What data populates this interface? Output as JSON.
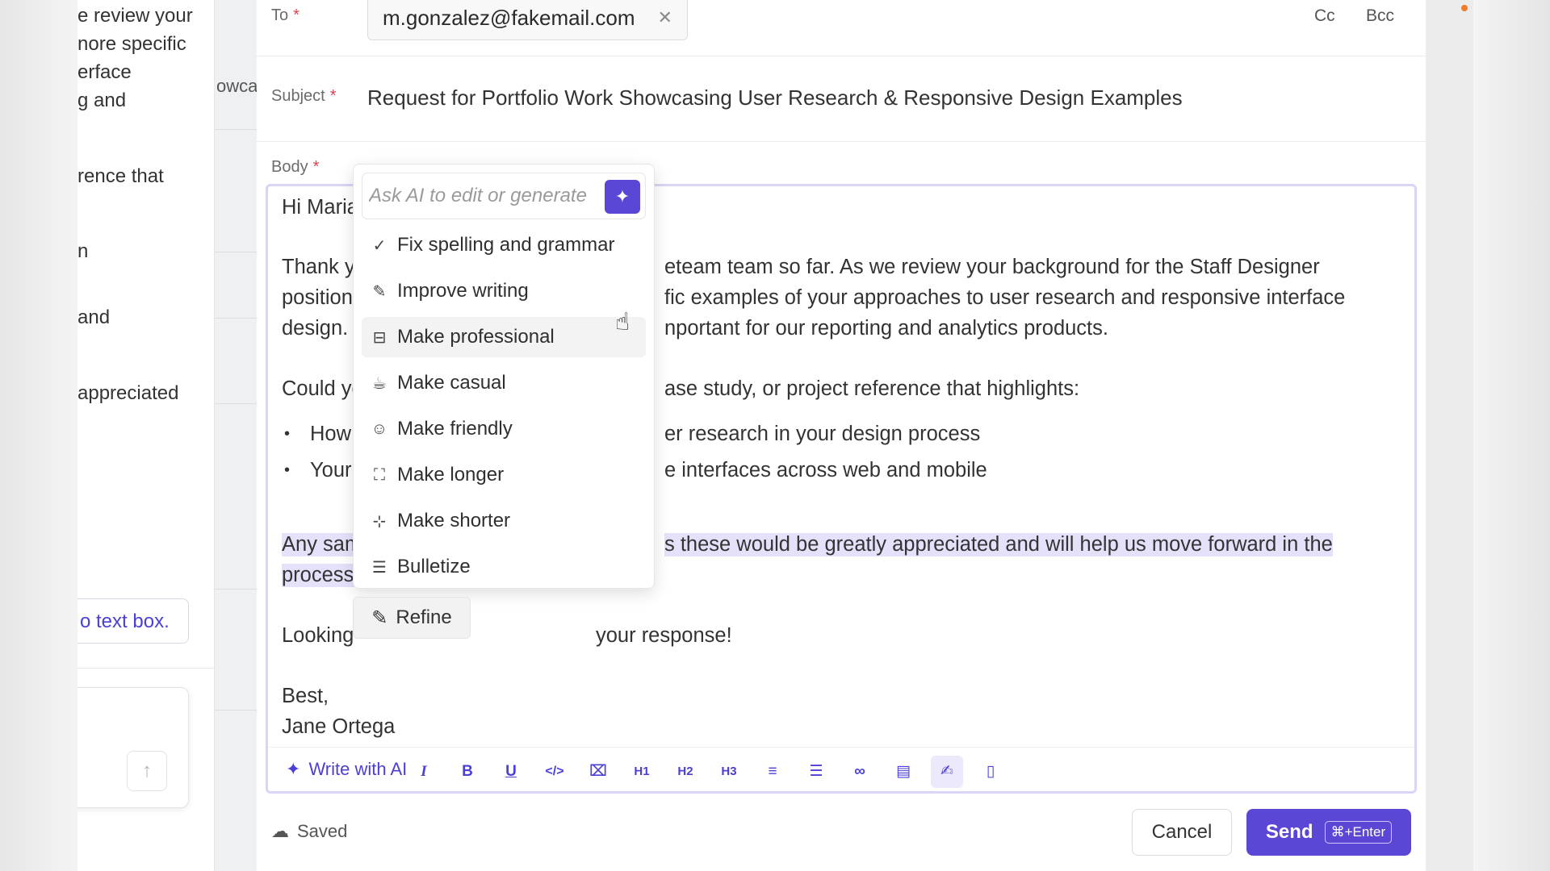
{
  "left_panel": {
    "lines": [
      "e review your",
      "nore specific",
      "erface",
      "g and",
      "rence that",
      "n",
      "and",
      "appreciated"
    ],
    "textbox_label": "o text box."
  },
  "back_strip": {
    "text": "owca"
  },
  "email": {
    "to_label": "To",
    "to_chip": "m.gonzalez@fakemail.com",
    "cc_label": "Cc",
    "bcc_label": "Bcc",
    "subject_label": "Subject",
    "subject_value": "Request for Portfolio Work Showcasing User Research & Responsive Design Examples",
    "body_label": "Body",
    "required_mark": "*",
    "body": {
      "greeting": "Hi Maria",
      "p1_l1_left": "Thank yo",
      "p1_l1_right": "eteam team so far. As we review your background for the Staff Designer",
      "p1_l2_left": "position,",
      "p1_l2_right": "fic examples of your approaches to user research and responsive interface",
      "p1_l3_left": "design. T",
      "p1_l3_right": "nportant for our reporting and analytics products.",
      "p2_left": "Could yo",
      "p2_right": "ase study, or project reference that highlights:",
      "b1_left": "How y",
      "b1_right": "er research in your design process",
      "b2_left": "Your c",
      "b2_right": "e interfaces across web and mobile",
      "p3_l1_left": "Any sam",
      "p3_l1_right": "s these would be greatly appreciated and will help us move forward in the",
      "p3_l2": "process.",
      "p4_left": "Looking",
      "p4_right": "your response!",
      "signoff": "Best,",
      "signature": "Jane Ortega"
    },
    "toolbar": {
      "write_ai": "Write with AI",
      "buttons": [
        "I",
        "B",
        "U",
        "</>",
        "H1",
        "H2",
        "H3"
      ]
    }
  },
  "footer": {
    "saved_label": "Saved",
    "cancel_label": "Cancel",
    "send_label": "Send",
    "send_shortcut": "⌘+Enter"
  },
  "ai_menu": {
    "placeholder": "Ask AI to edit or generate",
    "items": [
      {
        "label": "Fix spelling and grammar",
        "icon": "checkmark-icon"
      },
      {
        "label": "Improve writing",
        "icon": "pencil-icon"
      },
      {
        "label": "Make professional",
        "icon": "briefcase-icon"
      },
      {
        "label": "Make casual",
        "icon": "coffee-icon"
      },
      {
        "label": "Make friendly",
        "icon": "smile-icon"
      },
      {
        "label": "Make longer",
        "icon": "expand-icon"
      },
      {
        "label": "Make shorter",
        "icon": "collapse-icon"
      },
      {
        "label": "Bulletize",
        "icon": "list-icon"
      }
    ],
    "refine_label": "Refine"
  },
  "colors": {
    "accent": "#5a47d6",
    "highlight": "#e5e1fb",
    "required": "#e0424f",
    "editor_border": "#d9d5f7"
  }
}
